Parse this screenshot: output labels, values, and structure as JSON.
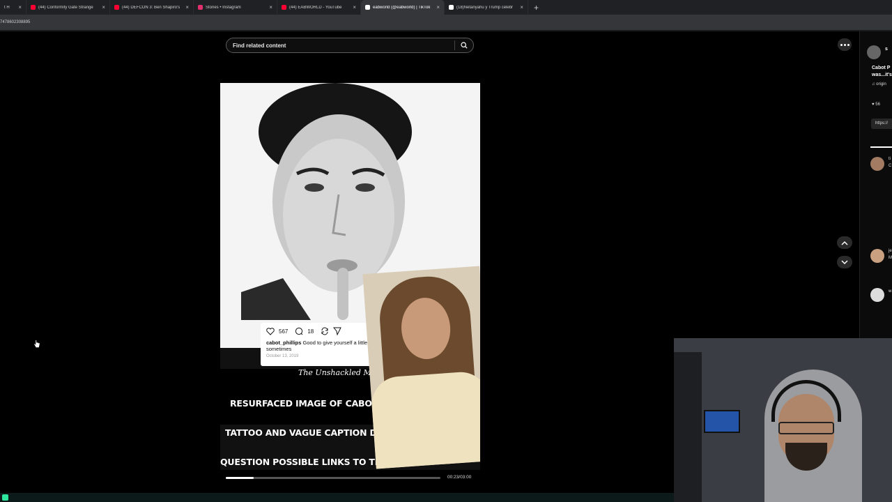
{
  "browser": {
    "tabs": [
      {
        "title": "t H",
        "color": "#888888"
      },
      {
        "title": "(44) Conformity Gate Strange",
        "color": "#ff0033"
      },
      {
        "title": "(44) DEFCON 3: Ben Shapiro's",
        "color": "#ff0033"
      },
      {
        "title": "Stories • Instagram",
        "color": "#e1306c"
      },
      {
        "title": "(44) EABWORLD - YouTube",
        "color": "#ff0033"
      },
      {
        "title": "eabworld (@eabworld) | TikTok",
        "color": "#ffffff",
        "active": true
      },
      {
        "title": "(18)Netanyahu y Trump celebr",
        "color": "#ffffff"
      }
    ],
    "url": "7478602308895"
  },
  "search": {
    "placeholder": "Find related content"
  },
  "video": {
    "instagram_likes": "567",
    "instagram_comments": "18",
    "instagram_user": "cabot_phillips",
    "instagram_caption": "Good to give yourself a little r",
    "instagram_caption_2": "sometimes",
    "instagram_date": "October 13, 2019",
    "brand": "The Unshackled Minds",
    "headline_1": "RESURFACED IMAGE OF CABOT PHIL",
    "headline_2": "TATTOO AND VAGUE CAPTION DR",
    "headline_3": "QUESTION POSSIBLE LINKS TO THE",
    "progress": 0.13,
    "time": "00:23/03:00"
  },
  "sidebar": {
    "author_initial": "s",
    "desc_1": "Cabot P",
    "desc_2": "was...it's",
    "sound": "origin",
    "likes": "56",
    "link": "https://",
    "comment_1": "ti",
    "comment_1b": "C",
    "comment_2": "je",
    "comment_2b": "M",
    "comment_3": "w"
  },
  "icons": {
    "search": "search-icon",
    "more": "more-horizontal-icon",
    "up": "chevron-up-icon",
    "down": "chevron-down-icon",
    "heart": "heart-icon",
    "comment": "comment-icon",
    "repost": "repost-icon",
    "send": "send-icon",
    "music": "music-note-icon",
    "cursor": "hand-cursor-icon"
  }
}
